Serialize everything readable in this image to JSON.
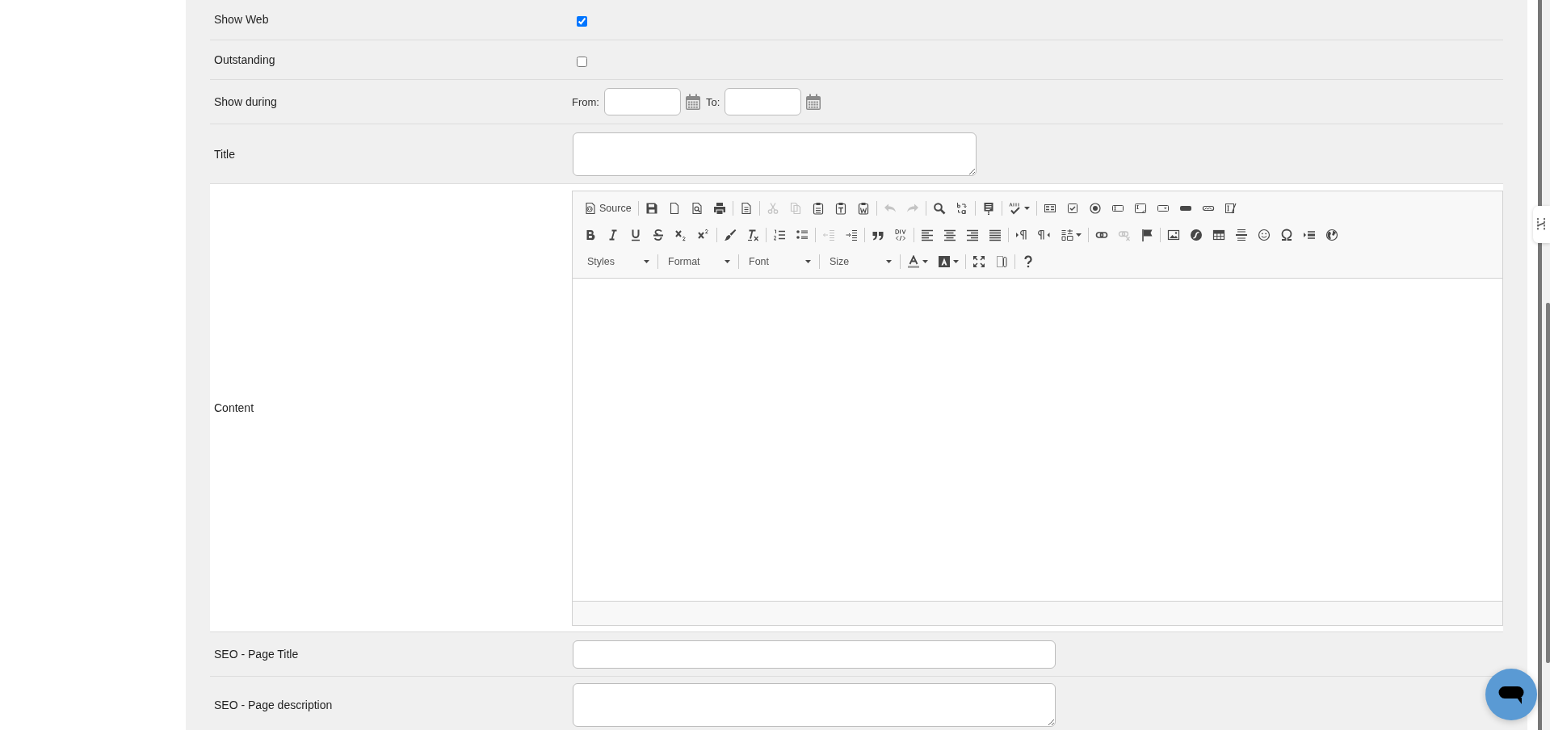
{
  "form": {
    "rows": [
      {
        "kind": "checkbox",
        "label": "Show Web",
        "checked": true
      },
      {
        "kind": "checkbox",
        "label": "Outstanding",
        "checked": false
      },
      {
        "kind": "daterange",
        "label": "Show during",
        "from_label": "From:",
        "to_label": "To:"
      },
      {
        "kind": "textarea",
        "label": "Title"
      },
      {
        "kind": "editor",
        "label": "Content",
        "toolbar": [
          {
            "groups": [
              {
                "items": [
                  {
                    "kind": "source",
                    "label": "Source",
                    "disabled": false
                  }
                ]
              },
              {
                "items": [
                  {
                    "kind": "save",
                    "disabled": false
                  },
                  {
                    "kind": "newpage",
                    "disabled": false
                  },
                  {
                    "kind": "preview",
                    "disabled": false
                  },
                  {
                    "kind": "print",
                    "disabled": false
                  }
                ]
              },
              {
                "items": [
                  {
                    "kind": "templates",
                    "disabled": false
                  }
                ]
              },
              {
                "items": [
                  {
                    "kind": "cut",
                    "disabled": true
                  },
                  {
                    "kind": "copy",
                    "disabled": true
                  },
                  {
                    "kind": "paste",
                    "disabled": false
                  },
                  {
                    "kind": "pastetext",
                    "disabled": false
                  },
                  {
                    "kind": "pastefromword",
                    "disabled": false
                  }
                ]
              },
              {
                "items": [
                  {
                    "kind": "undo",
                    "disabled": true
                  },
                  {
                    "kind": "redo",
                    "disabled": true
                  }
                ]
              },
              {
                "items": [
                  {
                    "kind": "find",
                    "disabled": false
                  },
                  {
                    "kind": "replace",
                    "disabled": false
                  }
                ]
              },
              {
                "items": [
                  {
                    "kind": "selectall",
                    "disabled": false
                  }
                ]
              },
              {
                "items": [
                  {
                    "kind": "spellcheck",
                    "disabled": false
                  }
                ]
              },
              {
                "items": [
                  {
                    "kind": "form",
                    "disabled": false
                  },
                  {
                    "kind": "checkbox",
                    "disabled": false
                  },
                  {
                    "kind": "radio",
                    "disabled": false
                  },
                  {
                    "kind": "textfield",
                    "disabled": false
                  },
                  {
                    "kind": "textarea",
                    "disabled": false
                  },
                  {
                    "kind": "select",
                    "disabled": false
                  },
                  {
                    "kind": "button",
                    "disabled": false
                  },
                  {
                    "kind": "imagebutton",
                    "disabled": false
                  },
                  {
                    "kind": "hiddenfield",
                    "disabled": false
                  }
                ]
              }
            ]
          },
          {
            "groups": [
              {
                "items": [
                  {
                    "kind": "bold",
                    "disabled": false
                  },
                  {
                    "kind": "italic",
                    "disabled": false
                  },
                  {
                    "kind": "underline",
                    "disabled": false
                  },
                  {
                    "kind": "strike",
                    "disabled": false
                  },
                  {
                    "kind": "subscript",
                    "disabled": false
                  },
                  {
                    "kind": "superscript",
                    "disabled": false
                  }
                ]
              },
              {
                "items": [
                  {
                    "kind": "copyformatting",
                    "disabled": false
                  },
                  {
                    "kind": "removeformat",
                    "disabled": false
                  }
                ]
              },
              {
                "items": [
                  {
                    "kind": "numberedlist",
                    "disabled": false
                  },
                  {
                    "kind": "bulletedlist",
                    "disabled": false
                  }
                ]
              },
              {
                "items": [
                  {
                    "kind": "outdent",
                    "disabled": true
                  },
                  {
                    "kind": "indent",
                    "disabled": false
                  }
                ]
              },
              {
                "items": [
                  {
                    "kind": "blockquote",
                    "disabled": false
                  },
                  {
                    "kind": "creatediv",
                    "disabled": false
                  }
                ]
              },
              {
                "items": [
                  {
                    "kind": "alignleft",
                    "disabled": false
                  },
                  {
                    "kind": "aligncenter",
                    "disabled": false
                  },
                  {
                    "kind": "alignright",
                    "disabled": false
                  },
                  {
                    "kind": "justify",
                    "disabled": false
                  }
                ]
              },
              {
                "items": [
                  {
                    "kind": "bidiltr",
                    "disabled": false
                  },
                  {
                    "kind": "bidirtl",
                    "disabled": false
                  },
                  {
                    "kind": "language",
                    "disabled": false
                  }
                ]
              },
              {
                "items": [
                  {
                    "kind": "link",
                    "disabled": false
                  },
                  {
                    "kind": "unlink",
                    "disabled": true
                  },
                  {
                    "kind": "anchor",
                    "disabled": false
                  }
                ]
              },
              {
                "items": [
                  {
                    "kind": "image",
                    "disabled": false
                  },
                  {
                    "kind": "flash",
                    "disabled": false
                  },
                  {
                    "kind": "table",
                    "disabled": false
                  },
                  {
                    "kind": "horizontalrule",
                    "disabled": false
                  },
                  {
                    "kind": "smiley",
                    "disabled": false
                  },
                  {
                    "kind": "specialchar",
                    "disabled": false
                  },
                  {
                    "kind": "pagebreak",
                    "disabled": false
                  },
                  {
                    "kind": "iframe",
                    "disabled": false
                  }
                ]
              }
            ]
          },
          {
            "groups": [
              {
                "items": [
                  {
                    "kind": "styles",
                    "label": "Styles",
                    "disabled": false
                  }
                ]
              },
              {
                "items": [
                  {
                    "kind": "format",
                    "label": "Format",
                    "disabled": false
                  }
                ]
              },
              {
                "items": [
                  {
                    "kind": "font",
                    "label": "Font",
                    "disabled": false
                  }
                ]
              },
              {
                "items": [
                  {
                    "kind": "size",
                    "label": "Size",
                    "disabled": false
                  }
                ]
              },
              {
                "items": [
                  {
                    "kind": "textcolor",
                    "disabled": false
                  },
                  {
                    "kind": "bgcolor",
                    "disabled": false
                  }
                ]
              },
              {
                "items": [
                  {
                    "kind": "maximize",
                    "disabled": false
                  },
                  {
                    "kind": "showblocks",
                    "disabled": false
                  }
                ]
              },
              {
                "items": [
                  {
                    "kind": "about",
                    "disabled": false
                  }
                ]
              }
            ]
          }
        ]
      },
      {
        "kind": "input",
        "label": "SEO - Page Title"
      },
      {
        "kind": "widetextarea",
        "label": "SEO - Page description"
      }
    ]
  }
}
